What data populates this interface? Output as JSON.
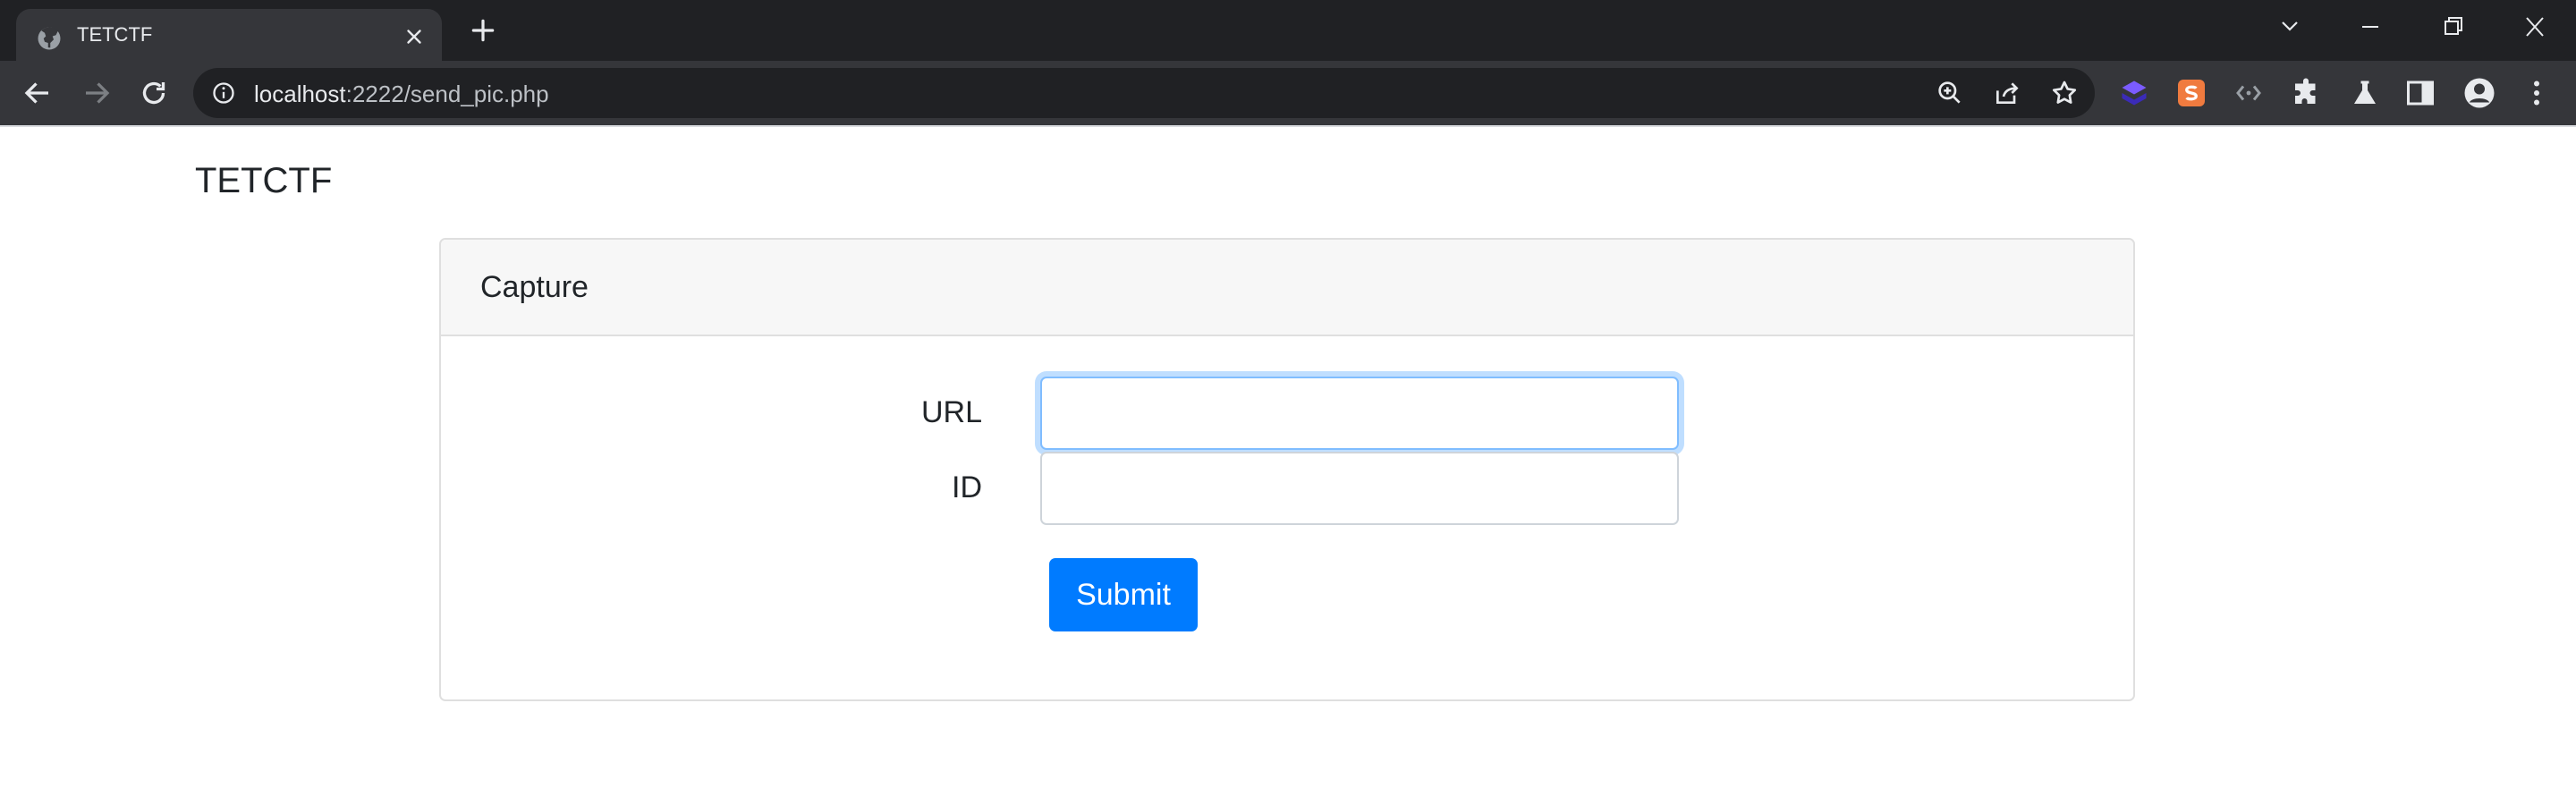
{
  "browser": {
    "tab": {
      "title": "TETCTF",
      "favicon": "globe-icon"
    },
    "address_bar": {
      "host": "localhost",
      "rest": ":2222/send_pic.php"
    },
    "icons": {
      "back": "arrow-left-icon",
      "forward": "arrow-right-icon",
      "reload": "reload-icon",
      "zoom": "zoom-icon",
      "share": "share-icon",
      "bookmark": "star-icon",
      "extensions": "puzzle-icon",
      "labs": "flask-icon",
      "side_panel": "side-panel-icon",
      "profile": "profile-icon",
      "menu": "kebab-menu-icon"
    },
    "colors": {
      "frame": "#202124",
      "toolbar": "#35363a"
    }
  },
  "page": {
    "brand": "TETCTF",
    "card": {
      "header": "Capture",
      "fields": [
        {
          "label": "URL",
          "value": "",
          "placeholder": ""
        },
        {
          "label": "ID",
          "value": "",
          "placeholder": ""
        }
      ],
      "submit_label": "Submit"
    },
    "colors": {
      "primary": "#007bff",
      "focus_ring": "#80bdff",
      "header_bg": "#f7f7f7"
    }
  }
}
